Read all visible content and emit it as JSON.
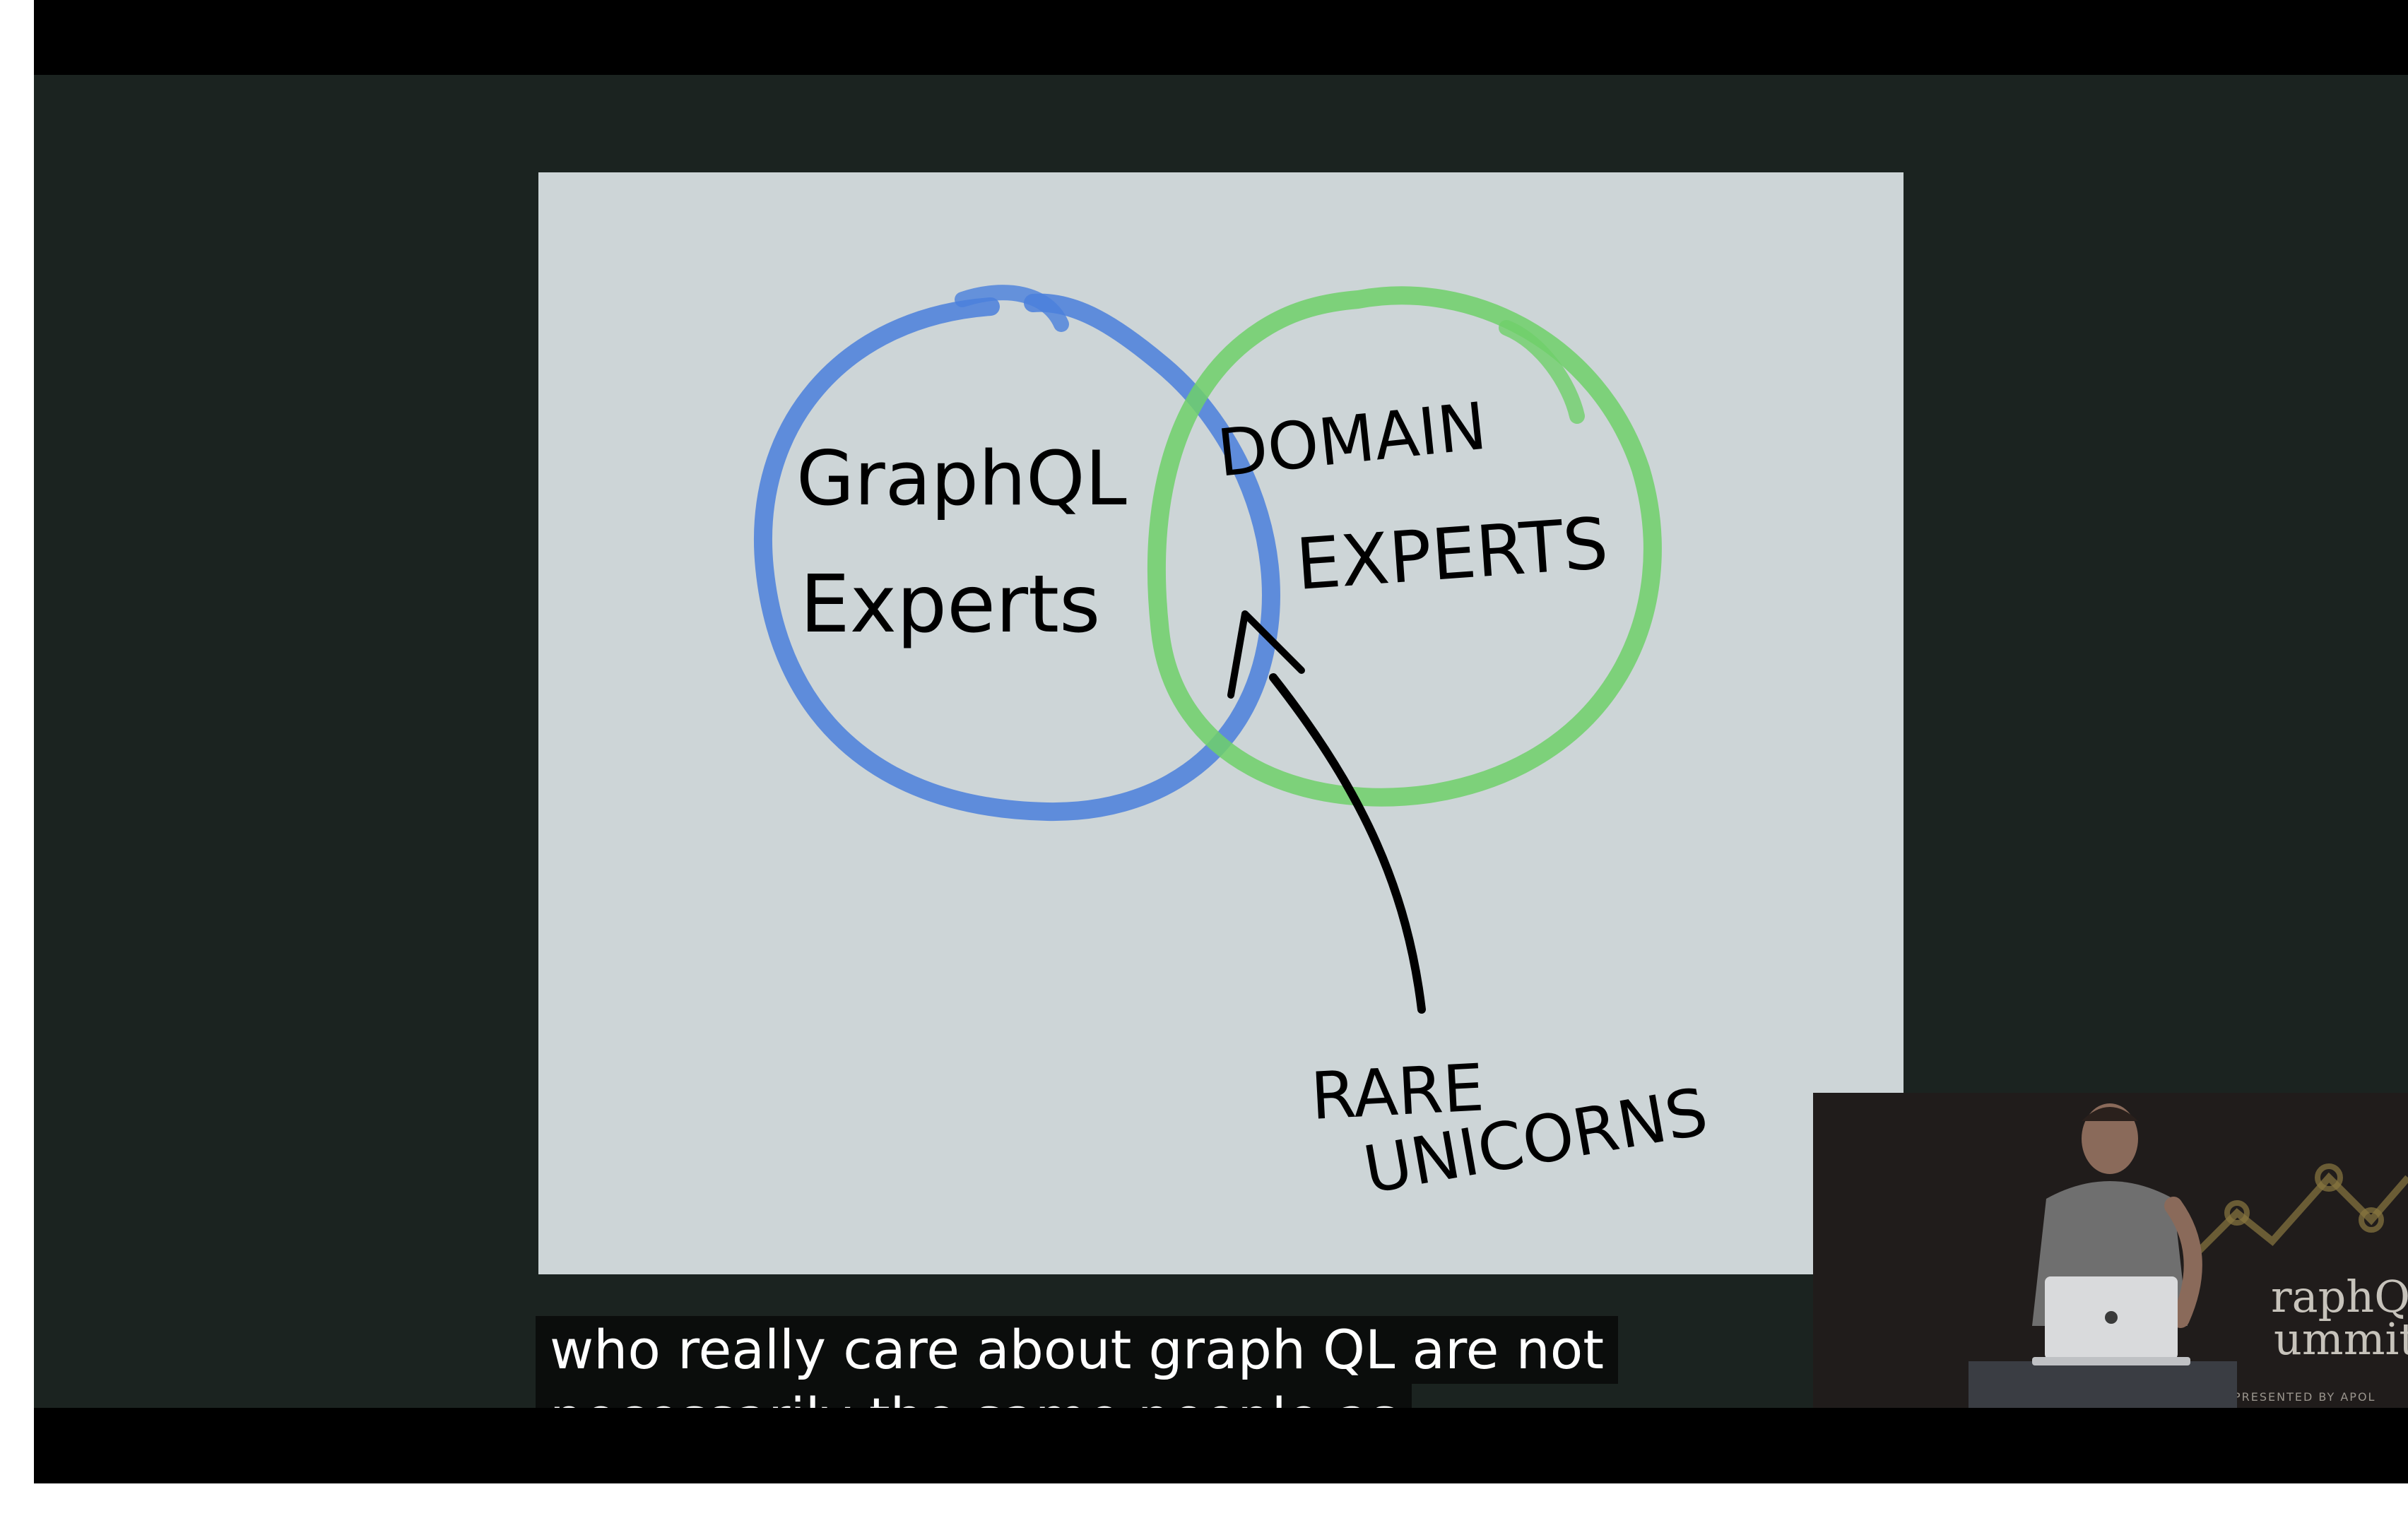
{
  "slide": {
    "left_circle_text": [
      "GraphQL",
      "Experts"
    ],
    "right_circle_text": [
      "DOMAIN",
      "EXPERTS"
    ],
    "arrow_label": [
      "RARE",
      "UNICORNS"
    ],
    "colors": {
      "left_circle": "#4a7fdc",
      "right_circle": "#6fd06a",
      "background": "#cdd5d7"
    }
  },
  "speaker_overlay": {
    "logo_text": [
      "raphQL",
      "ummit"
    ],
    "presented_by": "PRESENTED BY APOL"
  },
  "captions": {
    "line1": "who really care about graph QL are not",
    "line2": "necessarily the same people as"
  }
}
